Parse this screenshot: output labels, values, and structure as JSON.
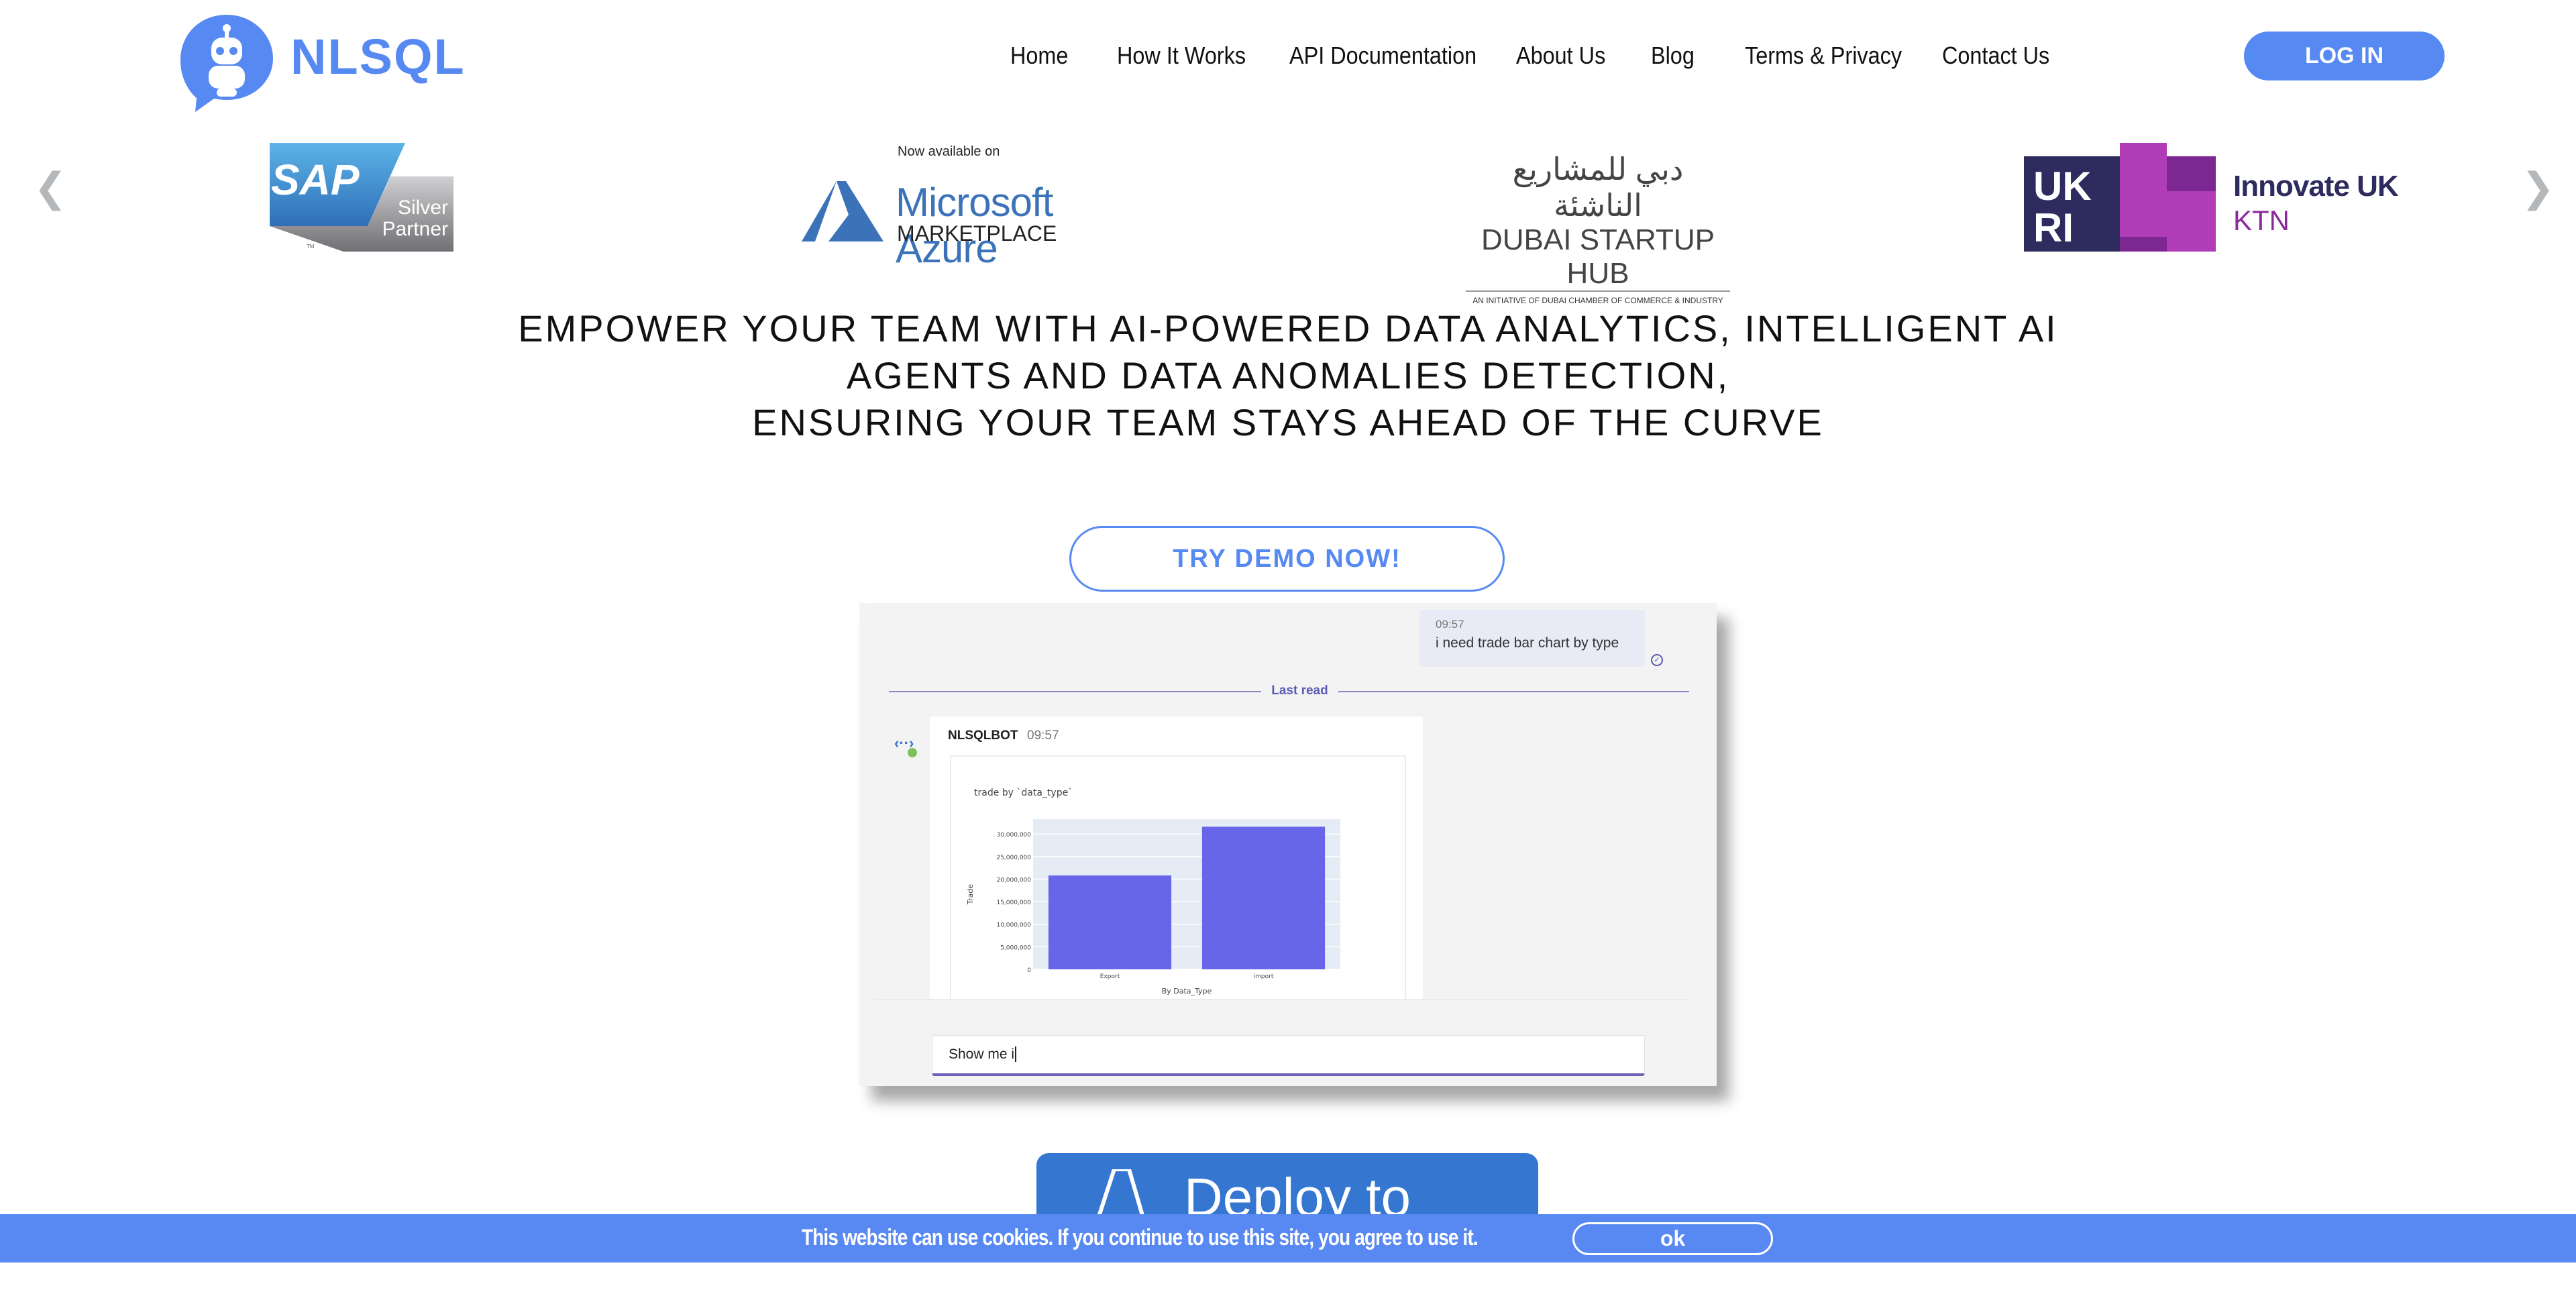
{
  "brand": {
    "name": "NLSQL",
    "color": "#5789f2"
  },
  "nav": {
    "items": [
      "Home",
      "How It Works",
      "API Documentation",
      "About Us",
      "Blog",
      "Terms & Privacy",
      "Contact Us"
    ],
    "login": "LOG IN"
  },
  "carousel": {
    "prev_icon": "chevron-left-icon",
    "next_icon": "chevron-right-icon",
    "sap": {
      "text": "SAP",
      "badge1": "Silver",
      "badge2": "Partner",
      "tm": "TM"
    },
    "azure": {
      "top": "Now available on",
      "name": "Microsoft Azure",
      "sub": "MARKETPLACE"
    },
    "dubai": {
      "arabic": "دبي للمشاريع الناشئة",
      "name": "DUBAI STARTUP HUB",
      "sub": "AN INITIATIVE OF DUBAI CHAMBER OF COMMERCE & INDUSTRY"
    },
    "ukri": {
      "mark1": "UK",
      "mark2": "RI",
      "name": "Innovate UK",
      "sub": "KTN"
    }
  },
  "headline": [
    "EMPOWER YOUR TEAM WITH AI-POWERED DATA ANALYTICS, INTELLIGENT AI",
    "AGENTS AND DATA ANOMALIES DETECTION,",
    "ENSURING YOUR TEAM STAYS AHEAD OF THE CURVE"
  ],
  "demo_button": "TRY DEMO NOW!",
  "chat": {
    "user_msg": {
      "time": "09:57",
      "text": "i need trade bar chart by type"
    },
    "divider": "Last read",
    "bot": {
      "name": "NLSQLBOT",
      "time": "09:57"
    },
    "input_value": "Show me i"
  },
  "chart_data": {
    "type": "bar",
    "title": "trade by `data_type`",
    "xlabel": "By Data_Type",
    "ylabel": "Trade",
    "categories": [
      "Export",
      "import"
    ],
    "values": [
      20800000,
      31600000
    ],
    "ylim": [
      0,
      33300000
    ],
    "yticks": [
      "0",
      "5,000,000",
      "10,000,000",
      "15,000,000",
      "20,000,000",
      "25,000,000",
      "30,000,000"
    ],
    "ytick_values": [
      0,
      5000000,
      10000000,
      15000000,
      20000000,
      25000000,
      30000000
    ],
    "bar_color": "#6766e9",
    "grid": true
  },
  "deploy_button": "Deploy to Azure",
  "cookie": {
    "text": "This website can use cookies. If you continue to use this site, you agree to use it.",
    "ok": "ok"
  }
}
